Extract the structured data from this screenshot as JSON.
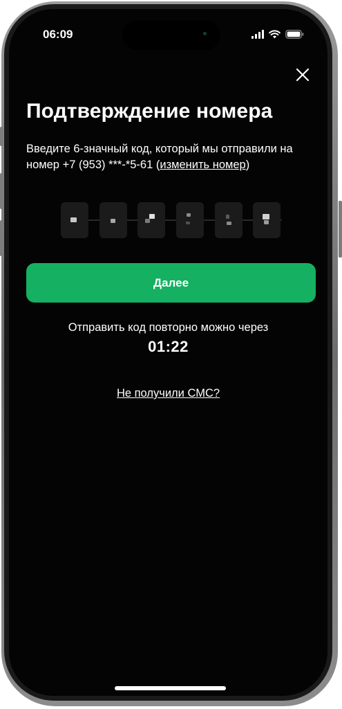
{
  "status_bar": {
    "time": "06:09"
  },
  "header": {
    "close_icon": "close-icon",
    "title": "Подтверждение номера"
  },
  "description": {
    "text_before": "Введите 6-значный код, который мы отправили на номер +7 (953) ***-*5-61 (",
    "change_link": "изменить номер",
    "text_after": ")"
  },
  "code": {
    "length": 6
  },
  "buttons": {
    "next_label": "Далее"
  },
  "resend": {
    "label": "Отправить код повторно можно через",
    "timer": "01:22"
  },
  "help": {
    "no_sms_link": "Не получили СМС?"
  },
  "colors": {
    "background": "#040404",
    "accent": "#15b061",
    "text": "#ffffff"
  }
}
